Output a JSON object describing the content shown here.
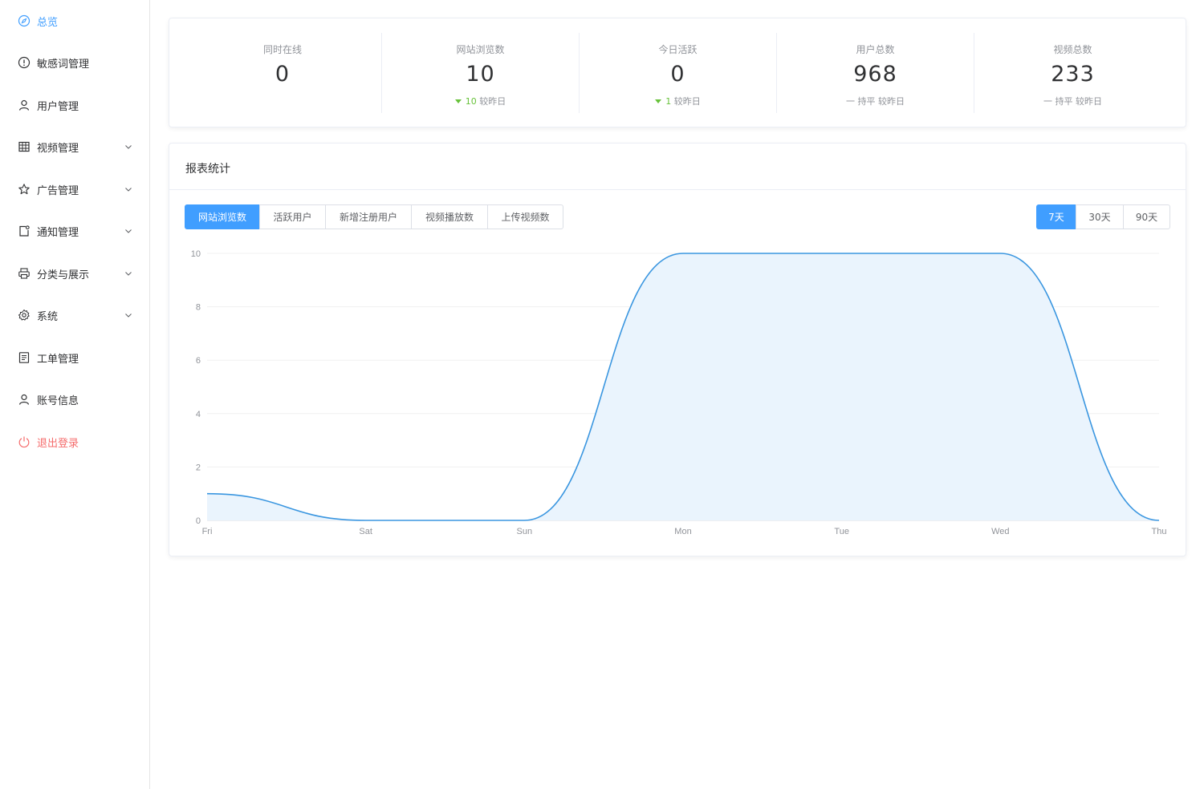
{
  "sidebar": {
    "items": [
      {
        "label": "总览",
        "icon": "compass-icon",
        "active": true
      },
      {
        "label": "敏感词管理",
        "icon": "warning-circle-icon"
      },
      {
        "label": "用户管理",
        "icon": "user-icon"
      },
      {
        "label": "视频管理",
        "icon": "grid-icon",
        "expandable": true
      },
      {
        "label": "广告管理",
        "icon": "star-icon",
        "expandable": true
      },
      {
        "label": "通知管理",
        "icon": "message-icon",
        "expandable": true
      },
      {
        "label": "分类与展示",
        "icon": "printer-icon",
        "expandable": true
      },
      {
        "label": "系统",
        "icon": "gear-icon",
        "expandable": true
      },
      {
        "label": "工单管理",
        "icon": "document-icon"
      },
      {
        "label": "账号信息",
        "icon": "user-icon"
      },
      {
        "label": "退出登录",
        "icon": "power-icon",
        "danger": true
      }
    ]
  },
  "stats": [
    {
      "title": "同时在线",
      "value": "0",
      "trend": "",
      "trend_value": "",
      "suffix": ""
    },
    {
      "title": "网站浏览数",
      "value": "10",
      "trend": "down",
      "trend_value": "10",
      "suffix": "较昨日"
    },
    {
      "title": "今日活跃",
      "value": "0",
      "trend": "down",
      "trend_value": "1",
      "suffix": "较昨日"
    },
    {
      "title": "用户总数",
      "value": "968",
      "trend": "flat",
      "trend_value": "一 持平",
      "suffix": "较昨日"
    },
    {
      "title": "视频总数",
      "value": "233",
      "trend": "flat",
      "trend_value": "一 持平",
      "suffix": "较昨日"
    }
  ],
  "report": {
    "title": "报表统计",
    "metric_tabs": [
      "网站浏览数",
      "活跃用户",
      "新增注册用户",
      "视频播放数",
      "上传视频数"
    ],
    "active_metric": 0,
    "range_tabs": [
      "7天",
      "30天",
      "90天"
    ],
    "active_range": 0
  },
  "colors": {
    "accent": "#409eff",
    "line": "#3a96e0",
    "area": "#eaf4fd",
    "up_down_green": "#67c23a",
    "danger": "#f56c6c"
  },
  "chart_data": {
    "type": "area",
    "categories": [
      "Fri",
      "Sat",
      "Sun",
      "Mon",
      "Tue",
      "Wed",
      "Thu"
    ],
    "values": [
      1,
      0,
      0,
      10,
      10,
      10,
      0
    ],
    "ylim": [
      0,
      10
    ],
    "yticks": [
      0,
      2,
      4,
      6,
      8,
      10
    ],
    "grid": true,
    "smooth": true
  }
}
